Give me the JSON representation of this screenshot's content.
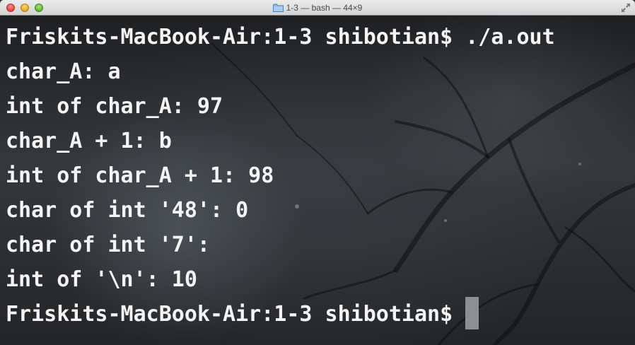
{
  "window": {
    "title": "1-3 — bash — 44×9",
    "title_icon": "folder-icon",
    "controls": [
      "close",
      "minimize",
      "zoom"
    ],
    "fullscreen_icon": "fullscreen-arrows-icon"
  },
  "terminal": {
    "lines": [
      "Friskits-MacBook-Air:1-3 shibotian$ ./a.out",
      "char_A: a",
      "int of char_A: 97",
      "char_A + 1: b",
      "int of char_A + 1: 98",
      "char of int '48': 0",
      "char of int '7':",
      "int of '\\n': 10",
      "Friskits-MacBook-Air:1-3 shibotian$"
    ],
    "text_color": "#f4f4f4",
    "cursor_color": "#8d8f91"
  }
}
